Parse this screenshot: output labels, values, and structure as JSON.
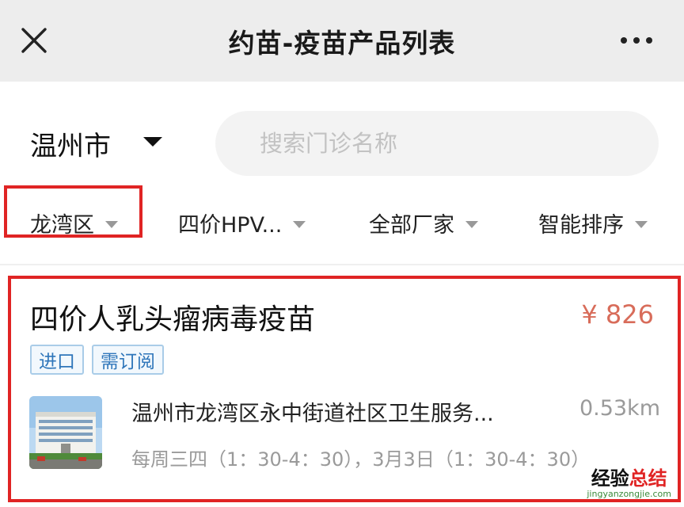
{
  "header": {
    "title": "约苗-疫苗产品列表",
    "close_icon": "close-icon",
    "more_icon": "more-dots-icon"
  },
  "location": {
    "city": "温州市",
    "caret_icon": "caret-down-icon"
  },
  "search": {
    "placeholder": "搜索门诊名称",
    "value": ""
  },
  "filters": {
    "district": "龙湾区",
    "vaccine": "四价HPV...",
    "manufacturer": "全部厂家",
    "sort": "智能排序"
  },
  "product": {
    "name": "四价人乳头瘤病毒疫苗",
    "price": "¥ 826",
    "tags": [
      "进口",
      "需订阅"
    ],
    "clinic": {
      "name": "温州市龙湾区永中街道社区卫生服务...",
      "distance": "0.53km",
      "hours": "每周三四（1：30-4：30），3月3日（1：30-4：30）"
    }
  },
  "watermark": {
    "part1": "经验",
    "part2": "总结",
    "url": "jingyanzongjie.com"
  },
  "colors": {
    "highlight_border": "#e02424",
    "price": "#d86c5a",
    "tag_text": "#2f76ba",
    "tag_border": "#a9cce8",
    "header_bg": "#ededed"
  }
}
